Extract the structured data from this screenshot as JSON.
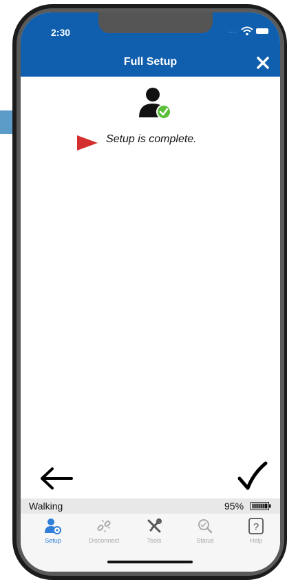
{
  "status_bar": {
    "time": "2:30",
    "signal": "...."
  },
  "header": {
    "title": "Full Setup"
  },
  "main": {
    "message": "Setup is complete."
  },
  "status_strip": {
    "activity": "Walking",
    "battery_percent": "95%"
  },
  "tabs": [
    {
      "label": "Setup",
      "icon": "user-gear-icon",
      "active": true
    },
    {
      "label": "Disconnect",
      "icon": "broken-link-icon",
      "active": false
    },
    {
      "label": "Tools",
      "icon": "tools-icon",
      "active": false
    },
    {
      "label": "Status",
      "icon": "status-search-icon",
      "active": false
    },
    {
      "label": "Help",
      "icon": "help-icon",
      "active": false
    }
  ],
  "colors": {
    "header": "#0f5fae",
    "active_tab": "#2f7fd8",
    "inactive_tab": "#a9a9a9",
    "check_badge": "#5bbf3a",
    "pointer": "#d42f2f"
  }
}
